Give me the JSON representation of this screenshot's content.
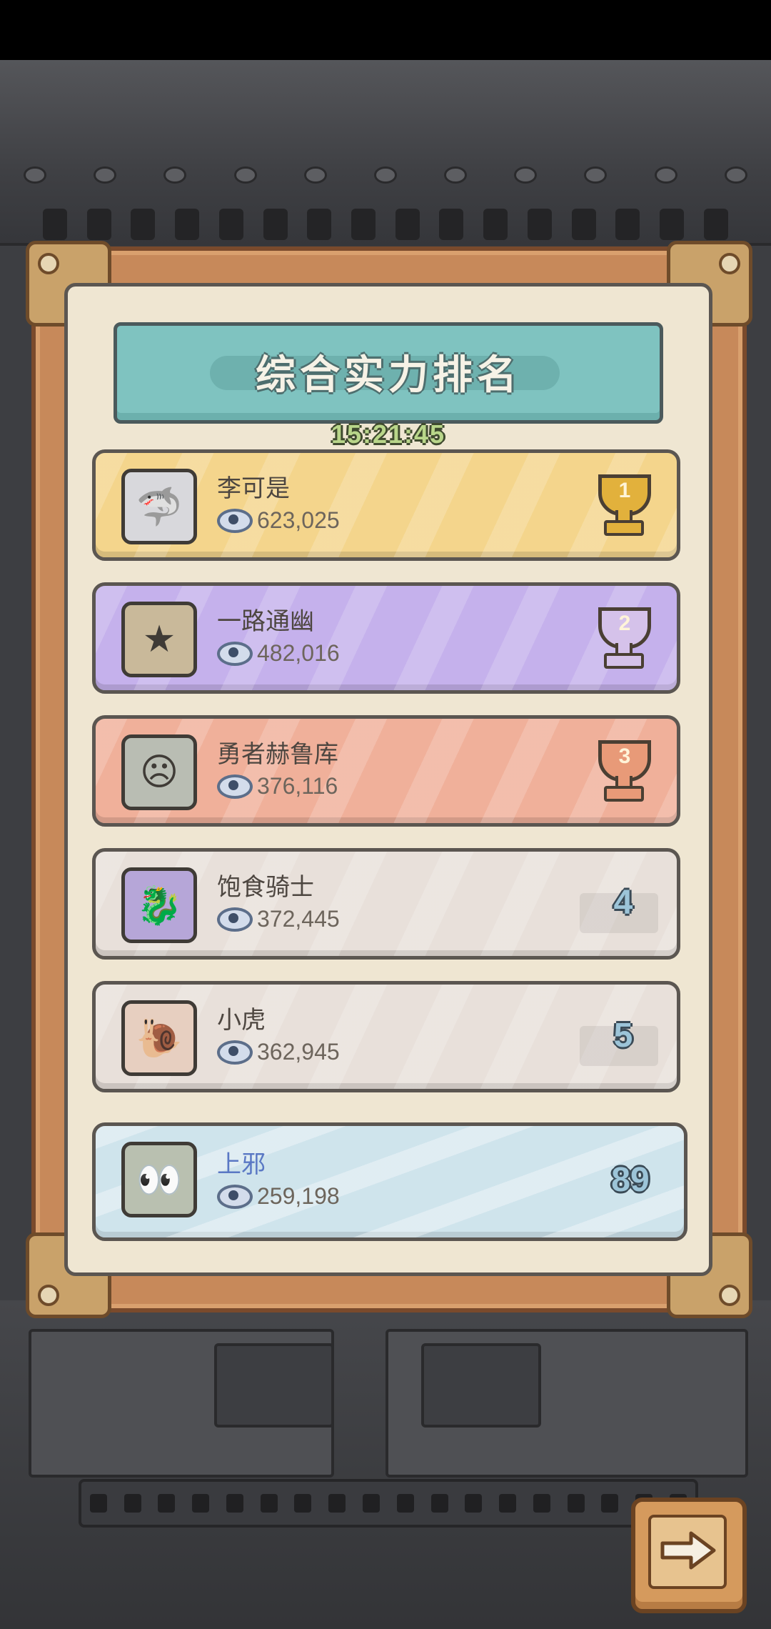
{
  "ranking": {
    "title": "综合实力排名",
    "timer": "15:21:45",
    "entries": [
      {
        "name": "李可是",
        "score": "623,025",
        "rank": "1",
        "tier": "gold",
        "avatar_icon": "shark-icon"
      },
      {
        "name": "一路通幽",
        "score": "482,016",
        "rank": "2",
        "tier": "purple",
        "avatar_icon": "trophy-statue-icon"
      },
      {
        "name": "勇者赫鲁库",
        "score": "376,116",
        "rank": "3",
        "tier": "bronze",
        "avatar_icon": "angry-face-icon"
      },
      {
        "name": "饱食骑士",
        "score": "372,445",
        "rank": "4",
        "tier": "plain",
        "avatar_icon": "dragon-icon"
      },
      {
        "name": "小虎",
        "score": "362,945",
        "rank": "5",
        "tier": "plain",
        "avatar_icon": "snail-icon"
      }
    ],
    "self": {
      "name": "上邪",
      "score": "259,198",
      "rank": "89",
      "avatar_icon": "green-eyed-creature-icon"
    }
  },
  "controls": {
    "next_icon": "arrow-right-icon"
  },
  "colors": {
    "gold_row": "#f4d58c",
    "purple_row": "#c5b1ec",
    "bronze_row": "#f0b09a",
    "plain_row": "#e8e0da",
    "self_row": "#cfe4ec",
    "banner": "#7fc3c0"
  }
}
